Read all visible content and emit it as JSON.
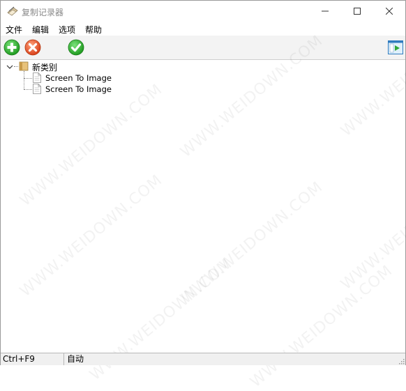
{
  "window": {
    "title": "复制记录器"
  },
  "menu": [
    "文件",
    "编辑",
    "选项",
    "帮助"
  ],
  "toolbar": {
    "add": {
      "icon": "plus-circle-icon",
      "color": "#2ea82e"
    },
    "delete": {
      "icon": "x-circle-icon",
      "color": "#e2582b"
    },
    "apply": {
      "icon": "check-circle-icon",
      "color": "#2ea82e"
    },
    "panel": {
      "icon": "panel-toggle-icon"
    }
  },
  "tree": {
    "category": {
      "label": "新类别",
      "expanded": true
    },
    "items": [
      "Screen To Image",
      "Screen To Image"
    ]
  },
  "status": {
    "hotkey": "Ctrl+F9",
    "mode": "自动"
  },
  "watermark": "WWW.WEIDOWN.COM"
}
